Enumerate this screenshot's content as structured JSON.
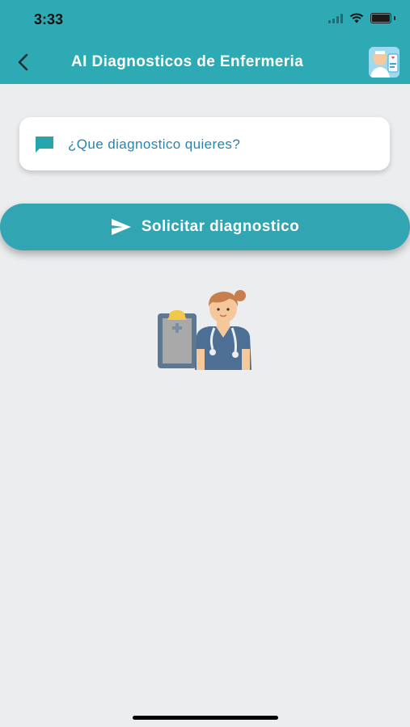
{
  "status_bar": {
    "time": "3:33"
  },
  "header": {
    "title": "AI Diagnosticos de Enfermeria"
  },
  "input": {
    "placeholder": "¿Que diagnostico quieres?",
    "value": ""
  },
  "submit_button": {
    "label": "Solicitar diagnostico"
  },
  "colors": {
    "accent": "#2daab4",
    "button": "#31a5b1",
    "placeholder": "#2a83a9",
    "background": "#ecedef"
  }
}
